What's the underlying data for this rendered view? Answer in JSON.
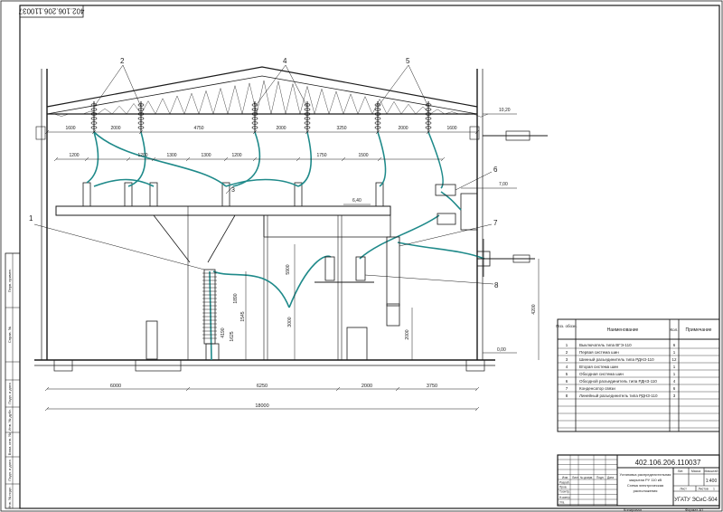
{
  "sheet": {
    "doc_code": "402.106.206.110037",
    "stamp_doc_code_top": "402.106.206.110037",
    "title_block": {
      "line1": "Установка распределительная",
      "line2": "закрытая РУ 110 кВ",
      "line3": "Схема электрическая",
      "line4": "расположения",
      "org": "УГАТУ ЭСиС-504",
      "scale": "1:400",
      "format": "Формат А1",
      "copied": "Копировал",
      "stage_hdr": "Лит.",
      "mass_hdr": "Масса",
      "scale_hdr": "Масштаб",
      "sheet_hdr": "Лист",
      "sheets_hdr": "Листов",
      "sheets_val": "1",
      "role_labels": [
        "Изм.",
        "Лист",
        "№ докум.",
        "Подп.",
        "Дата",
        "Разраб.",
        "Пров.",
        "Т.контр.",
        "Н.контр.",
        "Утв."
      ]
    },
    "left_strip": [
      "Перв. примен.",
      "Справ. №",
      "Подп. и дата",
      "Инв. № дубл.",
      "Взам. инв. №",
      "Подп. и дата",
      "Инв. № подл."
    ]
  },
  "callouts": [
    "1",
    "2",
    "3",
    "4",
    "5",
    "6",
    "7",
    "8"
  ],
  "dims_top": [
    "1600",
    "2000",
    "4750",
    "2000",
    "3250",
    "2000",
    "1600"
  ],
  "dims_second": [
    "1200",
    "1200",
    "1300",
    "1300",
    "1200",
    "1750",
    "1500"
  ],
  "dims_bottom": [
    "6000",
    "6250",
    "2000",
    "3750"
  ],
  "dim_total": "18000",
  "dims_vertical": [
    "5900",
    "4190",
    "1625",
    "1890",
    "1545",
    "3000",
    "2000",
    "4200"
  ],
  "level_marks": [
    "10,20",
    "7,00",
    "6,40",
    "0,00"
  ],
  "spec_table": {
    "headers": [
      "Поз. обозн.",
      "Наименование",
      "Кол.",
      "Примечание"
    ],
    "rows": [
      {
        "pos": "1",
        "name": "Выключатель типа ВГЭ-110",
        "qty": "6"
      },
      {
        "pos": "2",
        "name": "Первая система шин",
        "qty": "1"
      },
      {
        "pos": "3",
        "name": "Шинный разъединитель типа РДНЗ-110",
        "qty": "12"
      },
      {
        "pos": "4",
        "name": "Вторая система шин",
        "qty": "1"
      },
      {
        "pos": "5",
        "name": "Обходная система шин",
        "qty": "1"
      },
      {
        "pos": "6",
        "name": "Обходной разъединитель типа РДНЗ-110",
        "qty": "4"
      },
      {
        "pos": "7",
        "name": "Конденсатор связи",
        "qty": "6"
      },
      {
        "pos": "8",
        "name": "Линейный разъединитель типа РДНЗ-110",
        "qty": "3"
      }
    ]
  }
}
